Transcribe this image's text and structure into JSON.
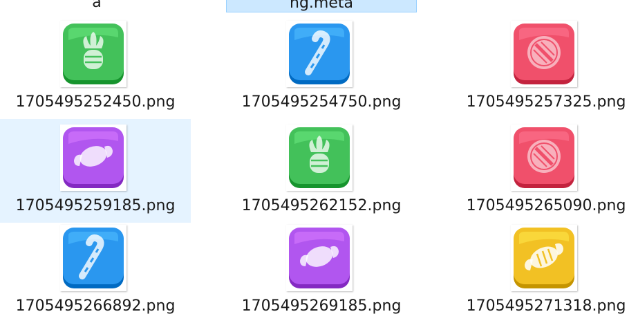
{
  "top_row": {
    "left_label": "a",
    "selected_label": "ng.meta"
  },
  "files": [
    {
      "name": "1705495252450.png",
      "icon": "pineapple-candy-icon",
      "color": "#43c15a"
    },
    {
      "name": "1705495254750.png",
      "icon": "candy-cane-icon",
      "color": "#2a97ef"
    },
    {
      "name": "1705495257325.png",
      "icon": "striped-mint-icon",
      "color": "#f0506b"
    },
    {
      "name": "1705495259185.png",
      "icon": "wrapped-candy-icon",
      "color": "#b156ef"
    },
    {
      "name": "1705495262152.png",
      "icon": "pineapple-candy-icon",
      "color": "#43c15a"
    },
    {
      "name": "1705495265090.png",
      "icon": "striped-mint-icon",
      "color": "#f0506b"
    },
    {
      "name": "1705495266892.png",
      "icon": "candy-cane-icon",
      "color": "#2a97ef"
    },
    {
      "name": "1705495269185.png",
      "icon": "wrapped-candy-icon",
      "color": "#b156ef"
    },
    {
      "name": "1705495271318.png",
      "icon": "striped-wrapped-candy-icon",
      "color": "#f2c124"
    }
  ]
}
